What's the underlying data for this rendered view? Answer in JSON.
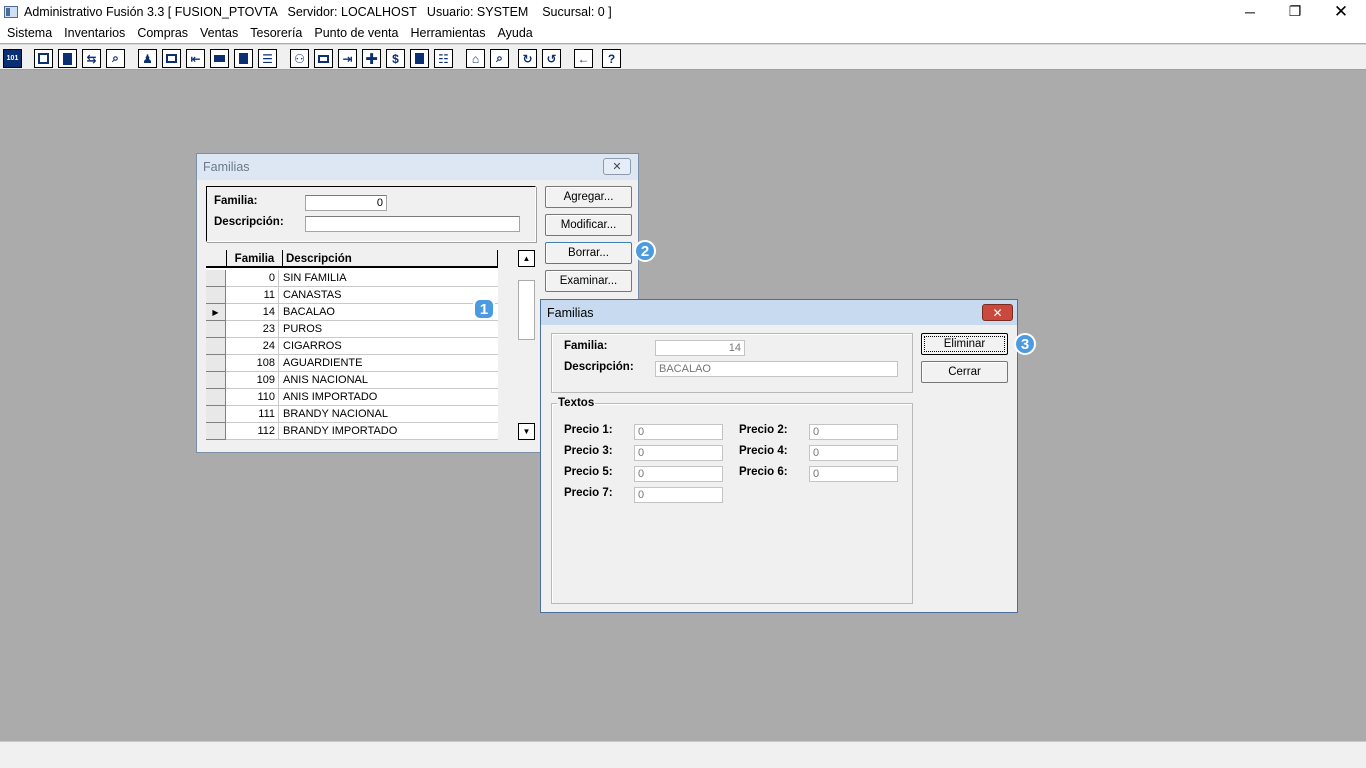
{
  "window": {
    "title": "Administrativo Fusión 3.3 [ FUSION_PTOVTA   Servidor: LOCALHOST   Usuario: SYSTEM    Sucursal: 0 ]",
    "minimize": "─",
    "maximize": "❐",
    "close": "✕"
  },
  "menu": [
    "Sistema",
    "Inventarios",
    "Compras",
    "Ventas",
    "Tesorería",
    "Punto de venta",
    "Herramientas",
    "Ayuda"
  ],
  "toolbar": {
    "first_label": "101"
  },
  "list_dialog": {
    "title": "Familias",
    "close": "✕",
    "familia_label": "Familia:",
    "familia_value": "0",
    "descripcion_label": "Descripción:",
    "descripcion_value": "",
    "buttons": {
      "agregar": "Agregar...",
      "modificar": "Modificar...",
      "borrar": "Borrar...",
      "examinar": "Examinar..."
    },
    "grid": {
      "col_familia": "Familia",
      "col_descripcion": "Descripción",
      "selected_marker": "▶",
      "rows": [
        {
          "familia": "0",
          "descripcion": "SIN FAMILIA"
        },
        {
          "familia": "11",
          "descripcion": "CANASTAS"
        },
        {
          "familia": "14",
          "descripcion": "BACALAO"
        },
        {
          "familia": "23",
          "descripcion": "PUROS"
        },
        {
          "familia": "24",
          "descripcion": "CIGARROS"
        },
        {
          "familia": "108",
          "descripcion": "AGUARDIENTE"
        },
        {
          "familia": "109",
          "descripcion": "ANIS NACIONAL"
        },
        {
          "familia": "110",
          "descripcion": "ANIS IMPORTADO"
        },
        {
          "familia": "111",
          "descripcion": "BRANDY NACIONAL"
        },
        {
          "familia": "112",
          "descripcion": "BRANDY IMPORTADO"
        }
      ]
    },
    "scroll_up": "▲",
    "scroll_down": "▼"
  },
  "detail_dialog": {
    "title": "Familias",
    "close": "✕",
    "familia_label": "Familia:",
    "familia_value": "14",
    "descripcion_label": "Descripción:",
    "descripcion_value": "BACALAO",
    "textos_label": "Textos",
    "precios": [
      {
        "label": "Precio 1:",
        "value": "0"
      },
      {
        "label": "Precio 2:",
        "value": "0"
      },
      {
        "label": "Precio 3:",
        "value": "0"
      },
      {
        "label": "Precio 4:",
        "value": "0"
      },
      {
        "label": "Precio 5:",
        "value": "0"
      },
      {
        "label": "Precio 6:",
        "value": "0"
      },
      {
        "label": "Precio 7:",
        "value": "0"
      }
    ],
    "buttons": {
      "eliminar": "Eliminar",
      "cerrar": "Cerrar"
    }
  },
  "badges": [
    "1",
    "2",
    "3"
  ],
  "colors": {
    "desktop": "#ababab",
    "badge": "#4c9be0",
    "close_red": "#c94a3c",
    "toolbar_icon": "#0b2f73"
  }
}
